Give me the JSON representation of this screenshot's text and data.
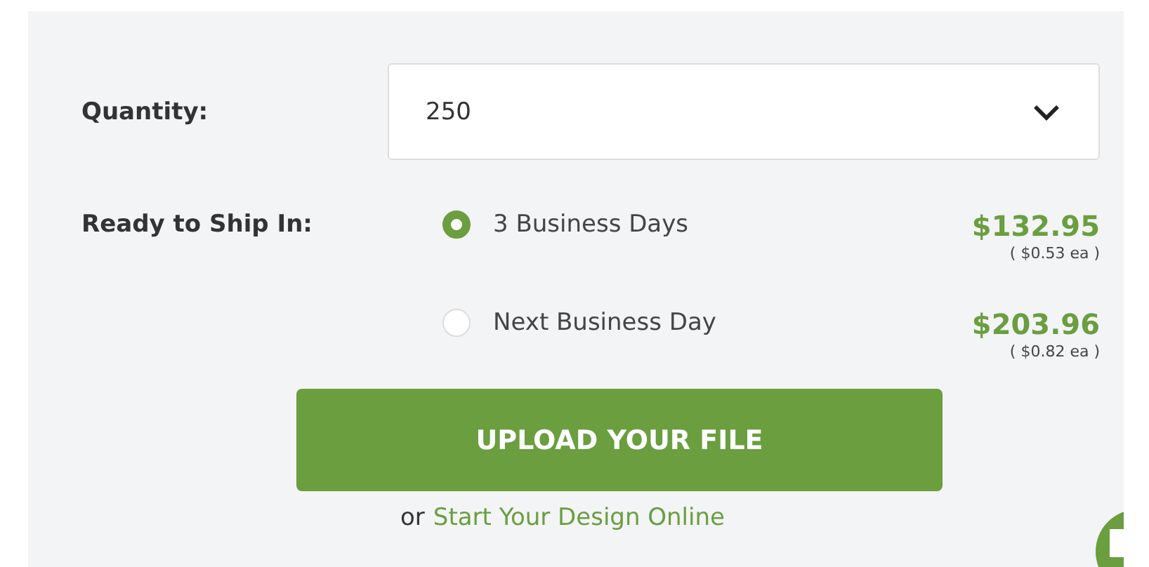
{
  "quantity": {
    "label": "Quantity:",
    "value": "250"
  },
  "shipping": {
    "label": "Ready to Ship In:",
    "options": [
      {
        "label": "3 Business Days",
        "selected": true,
        "price": "$132.95",
        "each": "( $0.53 ea )"
      },
      {
        "label": "Next Business Day",
        "selected": false,
        "price": "$203.96",
        "each": "( $0.82 ea )"
      }
    ]
  },
  "upload_button": "UPLOAD YOUR FILE",
  "alt_link": {
    "prefix": "or",
    "link": "Start Your Design Online"
  }
}
